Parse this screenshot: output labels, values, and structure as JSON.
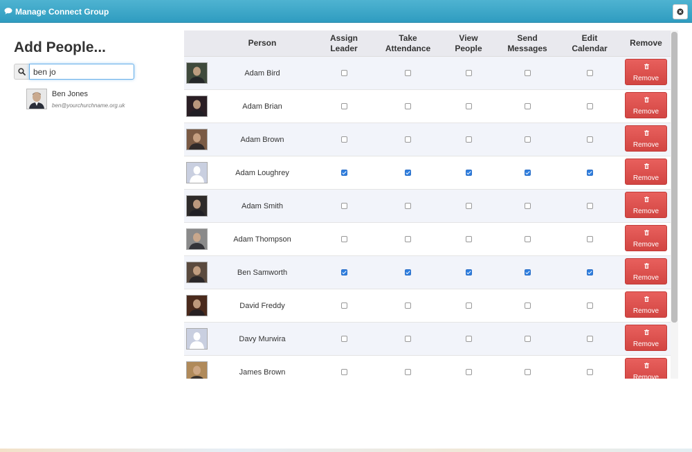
{
  "window": {
    "title": "Manage Connect Group",
    "icon": "chat-bubble-icon",
    "close_icon": "close-icon"
  },
  "left": {
    "heading": "Add People...",
    "search": {
      "value": "ben jo",
      "icon": "search-icon"
    },
    "results": [
      {
        "name": "Ben Jones",
        "email": "ben@yourchurchname.org.uk"
      }
    ]
  },
  "table": {
    "headers": {
      "person": "Person",
      "assign_leader": [
        "Assign",
        "Leader"
      ],
      "take_attendance": [
        "Take",
        "Attendance"
      ],
      "view_people": [
        "View",
        "People"
      ],
      "send_messages": [
        "Send",
        "Messages"
      ],
      "edit_calendar": [
        "Edit",
        "Calendar"
      ],
      "remove": "Remove"
    },
    "remove_label": "Remove",
    "rows": [
      {
        "name": "Adam Bird",
        "avatar": "photo",
        "tone": "#3f4a3c",
        "perms": [
          false,
          false,
          false,
          false,
          false
        ]
      },
      {
        "name": "Adam Brian",
        "avatar": "photo",
        "tone": "#2a1e24",
        "perms": [
          false,
          false,
          false,
          false,
          false
        ]
      },
      {
        "name": "Adam Brown",
        "avatar": "photo",
        "tone": "#7a5a44",
        "perms": [
          false,
          false,
          false,
          false,
          false
        ]
      },
      {
        "name": "Adam Loughrey",
        "avatar": "placeholder",
        "tone": "#c9cfe0",
        "perms": [
          true,
          true,
          true,
          true,
          true
        ]
      },
      {
        "name": "Adam Smith",
        "avatar": "photo",
        "tone": "#2e2b2a",
        "perms": [
          false,
          false,
          false,
          false,
          false
        ]
      },
      {
        "name": "Adam Thompson",
        "avatar": "photo",
        "tone": "#8a8a8a",
        "perms": [
          false,
          false,
          false,
          false,
          false
        ]
      },
      {
        "name": "Ben Samworth",
        "avatar": "photo",
        "tone": "#5a4a3e",
        "perms": [
          true,
          true,
          true,
          true,
          true
        ]
      },
      {
        "name": "David Freddy",
        "avatar": "photo",
        "tone": "#4a2a1c",
        "perms": [
          false,
          false,
          false,
          false,
          false
        ]
      },
      {
        "name": "Davy Murwira",
        "avatar": "placeholder",
        "tone": "#c9cfe0",
        "perms": [
          false,
          false,
          false,
          false,
          false
        ]
      },
      {
        "name": "James Brown",
        "avatar": "photo",
        "tone": "#b08a5a",
        "perms": [
          false,
          false,
          false,
          false,
          false
        ]
      }
    ]
  },
  "colors": {
    "header_bg": "#3aa6c9",
    "remove_btn": "#d9534f",
    "checkbox_on": "#2f7fe0"
  }
}
